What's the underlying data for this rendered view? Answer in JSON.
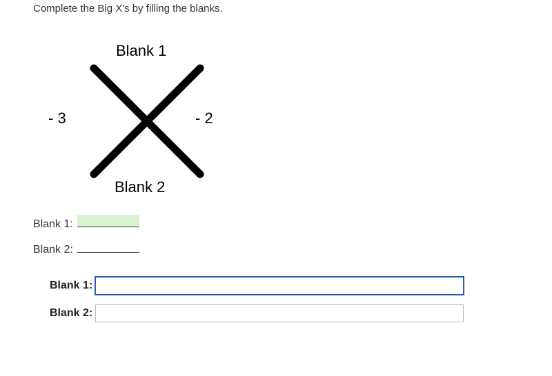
{
  "instruction": "Complete the Big X's by filling the blanks.",
  "diagram": {
    "top_label": "Blank 1",
    "left_value": "- 3",
    "right_value": "- 2",
    "bottom_label": "Blank 2"
  },
  "fill_blanks": {
    "row1_label": "Blank 1:",
    "row2_label": "Blank 2:"
  },
  "answer_inputs": {
    "row1_label": "Blank 1:",
    "row1_value": "",
    "row2_label": "Blank 2:",
    "row2_value": ""
  }
}
